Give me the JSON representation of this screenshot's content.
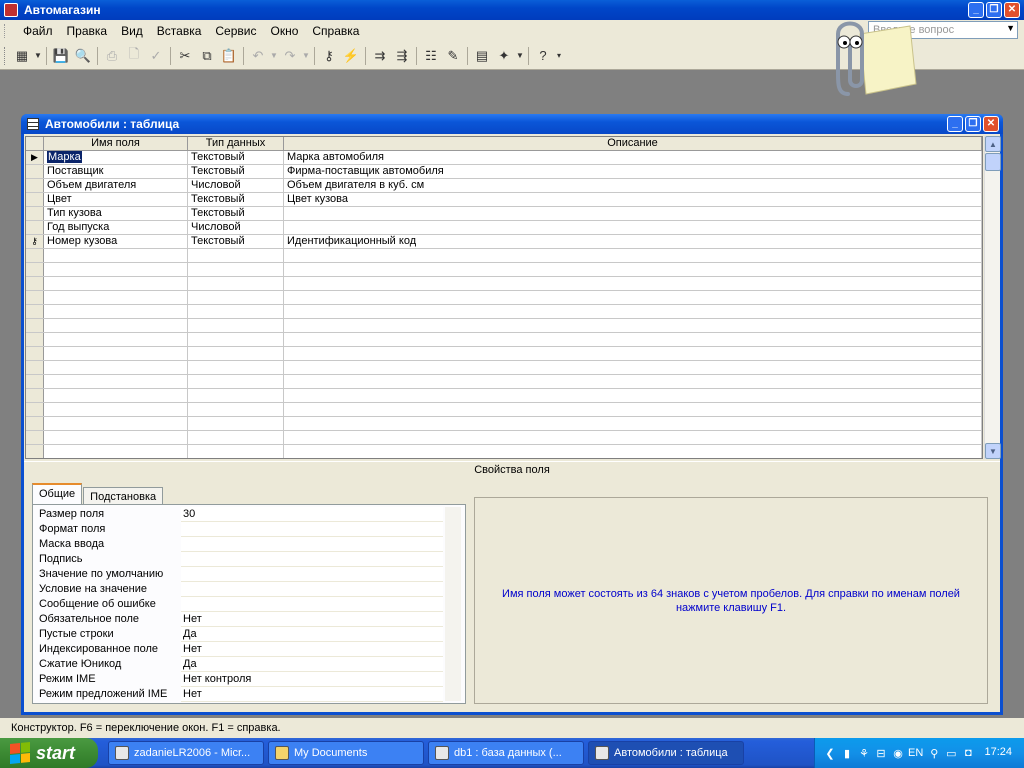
{
  "app": {
    "title": "Автомагазин"
  },
  "menu": [
    "Файл",
    "Правка",
    "Вид",
    "Вставка",
    "Сервис",
    "Окно",
    "Справка"
  ],
  "ask_placeholder": "Введите вопрос",
  "child": {
    "title": "Автомобили : таблица"
  },
  "grid": {
    "headers": [
      "Имя поля",
      "Тип данных",
      "Описание"
    ],
    "rows": [
      {
        "name": "Марка",
        "type": "Текстовый",
        "desc": "Марка автомобиля",
        "marker": "▶"
      },
      {
        "name": "Поставщик",
        "type": "Текстовый",
        "desc": "Фирма-поставщик автомобиля",
        "marker": ""
      },
      {
        "name": "Объем двигателя",
        "type": "Числовой",
        "desc": "Объем двигателя в куб. см",
        "marker": ""
      },
      {
        "name": "Цвет",
        "type": "Текстовый",
        "desc": "Цвет кузова",
        "marker": ""
      },
      {
        "name": "Тип кузова",
        "type": "Текстовый",
        "desc": "",
        "marker": ""
      },
      {
        "name": "Год выпуска",
        "type": "Числовой",
        "desc": "",
        "marker": ""
      },
      {
        "name": "Номер кузова",
        "type": "Текстовый",
        "desc": "Идентификационный код",
        "marker": "⚷"
      }
    ]
  },
  "props": {
    "section_label": "Свойства поля",
    "tabs": [
      "Общие",
      "Подстановка"
    ],
    "rows": [
      {
        "label": "Размер поля",
        "value": "30"
      },
      {
        "label": "Формат поля",
        "value": ""
      },
      {
        "label": "Маска ввода",
        "value": ""
      },
      {
        "label": "Подпись",
        "value": ""
      },
      {
        "label": "Значение по умолчанию",
        "value": ""
      },
      {
        "label": "Условие на значение",
        "value": ""
      },
      {
        "label": "Сообщение об ошибке",
        "value": ""
      },
      {
        "label": "Обязательное поле",
        "value": "Нет"
      },
      {
        "label": "Пустые строки",
        "value": "Да"
      },
      {
        "label": "Индексированное поле",
        "value": "Нет"
      },
      {
        "label": "Сжатие Юникод",
        "value": "Да"
      },
      {
        "label": "Режим IME",
        "value": "Нет контроля"
      },
      {
        "label": "Режим предложений IME",
        "value": "Нет"
      }
    ],
    "help": "Имя поля может состоять из 64 знаков с учетом пробелов.  Для справки по именам полей нажмите клавишу F1."
  },
  "status": "Конструктор.  F6 = переключение окон.  F1 = справка.",
  "taskbar": {
    "start": "start",
    "tasks": [
      {
        "label": "zadanieLR2006 - Micr...",
        "active": false
      },
      {
        "label": "My Documents",
        "active": false
      },
      {
        "label": "db1 : база данных (...",
        "active": false
      },
      {
        "label": "Автомобили : таблица",
        "active": true
      }
    ],
    "lang": "EN",
    "clock": "17:24"
  },
  "colors": {
    "title_blue": "#0046c8",
    "face": "#ece9d8",
    "help_text": "#0000cc",
    "start_green": "#3c8a33"
  }
}
